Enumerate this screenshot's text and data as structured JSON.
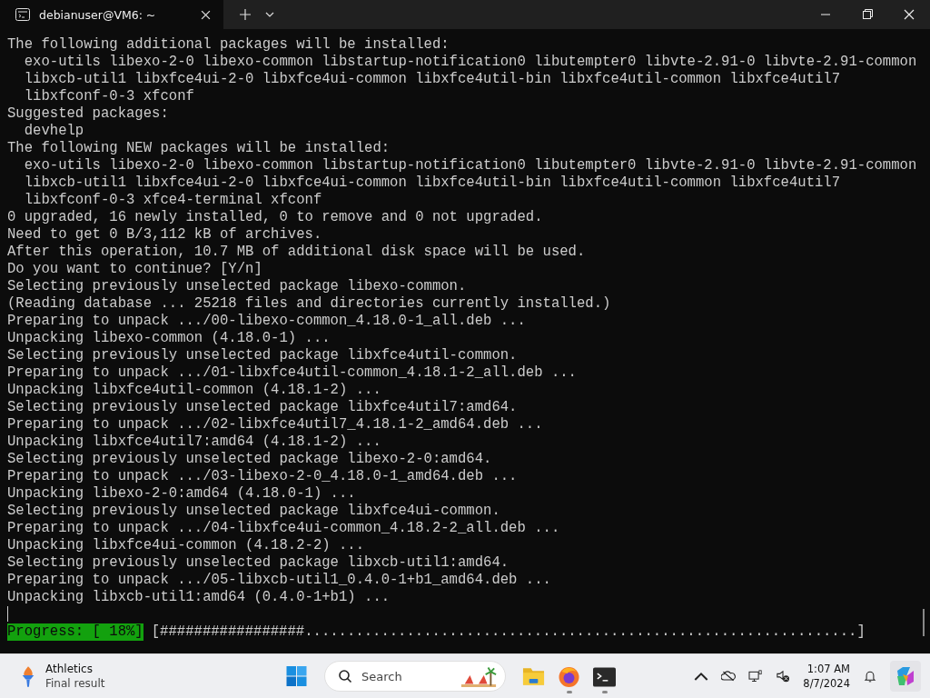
{
  "window": {
    "tab_title": "debianuser@VM6: ~"
  },
  "terminal": {
    "lines": [
      "The following additional packages will be installed:",
      "  exo-utils libexo-2-0 libexo-common libstartup-notification0 libutempter0 libvte-2.91-0 libvte-2.91-common",
      "  libxcb-util1 libxfce4ui-2-0 libxfce4ui-common libxfce4util-bin libxfce4util-common libxfce4util7",
      "  libxfconf-0-3 xfconf",
      "Suggested packages:",
      "  devhelp",
      "The following NEW packages will be installed:",
      "  exo-utils libexo-2-0 libexo-common libstartup-notification0 libutempter0 libvte-2.91-0 libvte-2.91-common",
      "  libxcb-util1 libxfce4ui-2-0 libxfce4ui-common libxfce4util-bin libxfce4util-common libxfce4util7",
      "  libxfconf-0-3 xfce4-terminal xfconf",
      "0 upgraded, 16 newly installed, 0 to remove and 0 not upgraded.",
      "Need to get 0 B/3,112 kB of archives.",
      "After this operation, 10.7 MB of additional disk space will be used.",
      "Do you want to continue? [Y/n]",
      "Selecting previously unselected package libexo-common.",
      "(Reading database ... 25218 files and directories currently installed.)",
      "Preparing to unpack .../00-libexo-common_4.18.0-1_all.deb ...",
      "Unpacking libexo-common (4.18.0-1) ...",
      "Selecting previously unselected package libxfce4util-common.",
      "Preparing to unpack .../01-libxfce4util-common_4.18.1-2_all.deb ...",
      "Unpacking libxfce4util-common (4.18.1-2) ...",
      "Selecting previously unselected package libxfce4util7:amd64.",
      "Preparing to unpack .../02-libxfce4util7_4.18.1-2_amd64.deb ...",
      "Unpacking libxfce4util7:amd64 (4.18.1-2) ...",
      "Selecting previously unselected package libexo-2-0:amd64.",
      "Preparing to unpack .../03-libexo-2-0_4.18.0-1_amd64.deb ...",
      "Unpacking libexo-2-0:amd64 (4.18.0-1) ...",
      "Selecting previously unselected package libxfce4ui-common.",
      "Preparing to unpack .../04-libxfce4ui-common_4.18.2-2_all.deb ...",
      "Unpacking libxfce4ui-common (4.18.2-2) ...",
      "Selecting previously unselected package libxcb-util1:amd64.",
      "Preparing to unpack .../05-libxcb-util1_0.4.0-1+b1_amd64.deb ...",
      "Unpacking libxcb-util1:amd64 (0.4.0-1+b1) ..."
    ],
    "progress_label": "Progress: [ 18%]",
    "progress_bar": "[#################.................................................................]"
  },
  "taskbar": {
    "widget": {
      "title": "Athletics",
      "subtitle": "Final result"
    },
    "search": {
      "placeholder": "Search"
    },
    "clock": {
      "time": "1:07 AM",
      "date": "8/7/2024"
    }
  }
}
